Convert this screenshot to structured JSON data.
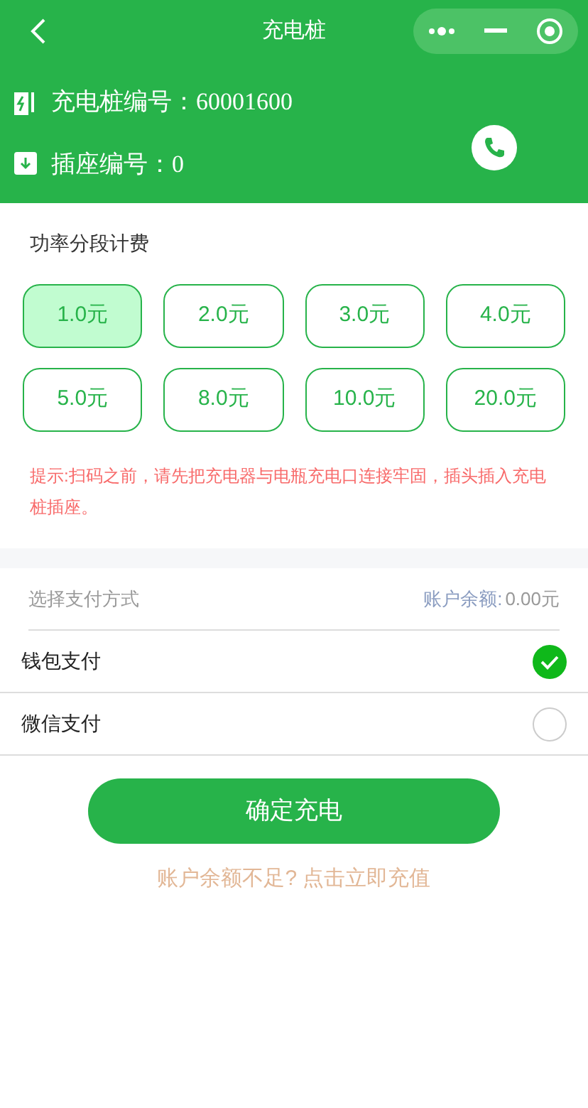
{
  "nav": {
    "title": "充电桩"
  },
  "info": {
    "pile_label": "充电桩编号：",
    "pile_value": "60001600",
    "socket_label": "插座编号：",
    "socket_value": "0"
  },
  "pricing": {
    "title": "功率分段计费",
    "options": [
      {
        "label": "1.0元",
        "selected": true
      },
      {
        "label": "2.0元",
        "selected": false
      },
      {
        "label": "3.0元",
        "selected": false
      },
      {
        "label": "4.0元",
        "selected": false
      },
      {
        "label": "5.0元",
        "selected": false
      },
      {
        "label": "8.0元",
        "selected": false
      },
      {
        "label": "10.0元",
        "selected": false
      },
      {
        "label": "20.0元",
        "selected": false
      }
    ],
    "tip": "提示:扫码之前，请先把充电器与电瓶充电口连接牢固，插头插入充电桩插座。"
  },
  "payment": {
    "title": "选择支付方式",
    "balance_label": "账户余额:",
    "balance_value": "0.00元",
    "methods": [
      {
        "label": "钱包支付",
        "selected": true
      },
      {
        "label": "微信支付",
        "selected": false
      }
    ]
  },
  "confirm_button": "确定充电",
  "recharge_link": "账户余额不足? 点击立即充值"
}
